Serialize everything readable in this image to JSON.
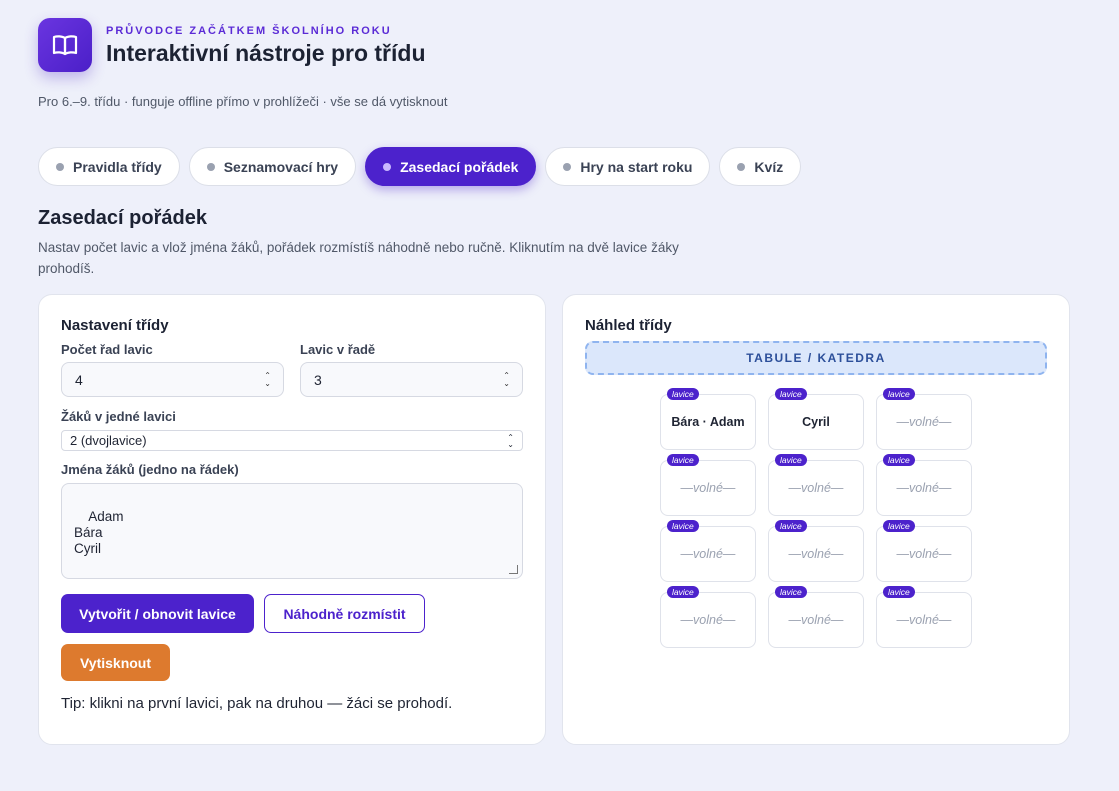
{
  "header": {
    "kicker": "PRŮVODCE ZAČÁTKEM ŠKOLNÍHO ROKU",
    "title": "Interaktivní nástroje pro třídu",
    "subtitle": "Pro 6.–9. třídu · funguje offline přímo v prohlížeči · vše se dá vytisknout",
    "logo_icon": "open-book-icon"
  },
  "tabs": [
    {
      "label": "Pravidla třídy",
      "active": false
    },
    {
      "label": "Seznamovací hry",
      "active": false
    },
    {
      "label": "Zasedací pořádek",
      "active": true
    },
    {
      "label": "Hry na start roku",
      "active": false
    },
    {
      "label": "Kvíz",
      "active": false
    }
  ],
  "section": {
    "title": "Zasedací pořádek",
    "description": "Nastav počet lavic a vlož jména žáků, pořádek rozmístíš náhodně nebo ručně. Kliknutím na dvě lavice žáky prohodíš."
  },
  "settings": {
    "title": "Nastavení třídy",
    "rows_label": "Počet řad lavic",
    "rows_value": "4",
    "per_row_label": "Lavic v řadě",
    "per_row_value": "3",
    "per_desk_label": "Žáků v jedné lavici",
    "per_desk_value": "2 (dvojlavice)",
    "names_label": "Jména žáků (jedno na řádek)",
    "names_value": "Adam\nBára\nCyril",
    "create_button": "Vytvořit / obnovit lavice",
    "random_button": "Náhodně rozmístit",
    "print_button": "Vytisknout",
    "tip": "Tip: klikni na první lavici, pak na druhou — žáci se prohodí."
  },
  "preview": {
    "title": "Náhled třídy",
    "board": "TABULE / KATEDRA",
    "badge": "lavice",
    "desks": [
      {
        "text": "Bára · Adam",
        "empty": false
      },
      {
        "text": "Cyril",
        "empty": false
      },
      {
        "text": "—volné—",
        "empty": true
      },
      {
        "text": "—volné—",
        "empty": true
      },
      {
        "text": "—volné—",
        "empty": true
      },
      {
        "text": "—volné—",
        "empty": true
      },
      {
        "text": "—volné—",
        "empty": true
      },
      {
        "text": "—volné—",
        "empty": true
      },
      {
        "text": "—volné—",
        "empty": true
      },
      {
        "text": "—volné—",
        "empty": true
      },
      {
        "text": "—volné—",
        "empty": true
      },
      {
        "text": "—volné—",
        "empty": true
      }
    ]
  },
  "colors": {
    "accent": "#4c22cc",
    "print": "#dd7a2e",
    "background": "#eef0fa"
  }
}
